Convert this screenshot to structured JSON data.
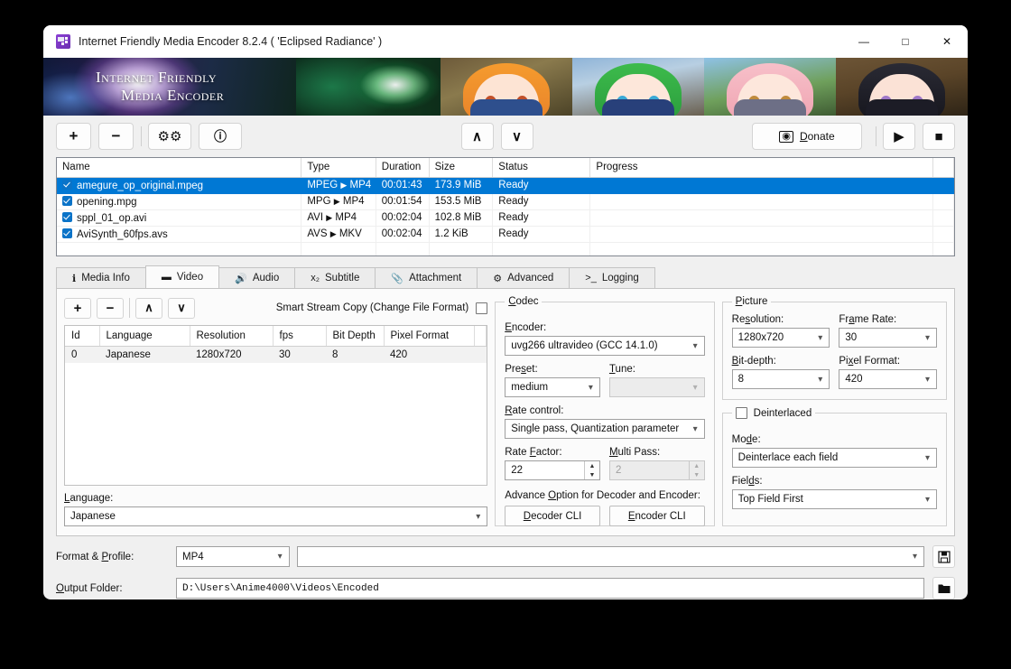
{
  "window": {
    "title": "Internet Friendly Media Encoder 8.2.4 ( 'Eclipsed Radiance' )",
    "minimize": "—",
    "maximize": "□",
    "close": "✕"
  },
  "banner": {
    "logo_line1": "Internet Friendly",
    "logo_line2": "Media Encoder"
  },
  "toolbar": {
    "add": "+",
    "remove": "−",
    "settings": "⚙",
    "info": "ℹ",
    "move_up": "∧",
    "move_down": "∨",
    "donate": "Donate",
    "donate_icon": "💵",
    "start": "▶",
    "stop": "■"
  },
  "filelist": {
    "columns": [
      "Name",
      "Type",
      "Duration",
      "Size",
      "Status",
      "Progress"
    ],
    "rows": [
      {
        "checked": true,
        "name": "amegure_op_original.mpeg",
        "type_from": "MPEG",
        "type_to": "MP4",
        "duration": "00:01:43",
        "size": "173.9 MiB",
        "status": "Ready",
        "progress": "",
        "selected": true
      },
      {
        "checked": true,
        "name": "opening.mpg",
        "type_from": "MPG",
        "type_to": "MP4",
        "duration": "00:01:54",
        "size": "153.5 MiB",
        "status": "Ready",
        "progress": "",
        "selected": false
      },
      {
        "checked": true,
        "name": "sppl_01_op.avi",
        "type_from": "AVI",
        "type_to": "MP4",
        "duration": "00:02:04",
        "size": "102.8 MiB",
        "status": "Ready",
        "progress": "",
        "selected": false
      },
      {
        "checked": true,
        "name": "AviSynth_60fps.avs",
        "type_from": "AVS",
        "type_to": "MKV",
        "duration": "00:02:04",
        "size": "1.2 KiB",
        "status": "Ready",
        "progress": "",
        "selected": false
      }
    ]
  },
  "tabs": [
    {
      "label": "Media Info",
      "icon": "info-icon",
      "glyph": "ℹ",
      "active": false
    },
    {
      "label": "Video",
      "icon": "video-camera-icon",
      "glyph": "▬",
      "active": true
    },
    {
      "label": "Audio",
      "icon": "speaker-icon",
      "glyph": "🔊",
      "active": false
    },
    {
      "label": "Subtitle",
      "icon": "subtitle-icon",
      "glyph": "x₂",
      "active": false
    },
    {
      "label": "Attachment",
      "icon": "paperclip-icon",
      "glyph": "📎",
      "active": false
    },
    {
      "label": "Advanced",
      "icon": "gear-icon",
      "glyph": "⚙",
      "active": false
    },
    {
      "label": "Logging",
      "icon": "console-icon",
      "glyph": ">_",
      "active": false
    }
  ],
  "video_tab": {
    "track_toolbar": {
      "add": "+",
      "remove": "−",
      "move_up": "∧",
      "move_down": "∨",
      "smart_stream_copy_label": "Smart Stream Copy (Change File Format)",
      "smart_stream_copy_checked": false
    },
    "track_table": {
      "columns": [
        "Id",
        "Language",
        "Resolution",
        "fps",
        "Bit Depth",
        "Pixel Format"
      ],
      "rows": [
        {
          "id": "0",
          "language": "Japanese",
          "resolution": "1280x720",
          "fps": "30",
          "bit_depth": "8",
          "pixel_format": "420"
        }
      ]
    },
    "language": {
      "label": "Language:",
      "value": "Japanese"
    },
    "codec": {
      "group_label": "Codec",
      "encoder_label": "Encoder:",
      "encoder_value": "uvg266 ultravideo (GCC 14.1.0)",
      "preset_label": "Preset:",
      "preset_value": "medium",
      "tune_label": "Tune:",
      "tune_value": "",
      "tune_disabled": true,
      "rate_control_label": "Rate control:",
      "rate_control_value": "Single pass, Quantization parameter",
      "rate_factor_label": "Rate Factor:",
      "rate_factor_value": "22",
      "multi_pass_label": "Multi Pass:",
      "multi_pass_value": "2",
      "multi_pass_disabled": true,
      "advance_label": "Advance Option for Decoder and Encoder:",
      "decoder_cli": "Decoder CLI",
      "encoder_cli": "Encoder CLI"
    },
    "picture": {
      "group_label": "Picture",
      "resolution_label": "Resolution:",
      "resolution_value": "1280x720",
      "frame_rate_label": "Frame Rate:",
      "frame_rate_value": "30",
      "bit_depth_label": "Bit-depth:",
      "bit_depth_value": "8",
      "pixel_format_label": "Pixel Format:",
      "pixel_format_value": "420"
    },
    "deinterlace": {
      "group_label": "Deinterlaced",
      "checked": false,
      "mode_label": "Mode:",
      "mode_value": "Deinterlace each field",
      "fields_label": "Fields:",
      "fields_value": "Top Field First"
    }
  },
  "bottom": {
    "format_profile_label": "Format & Profile:",
    "format_value": "MP4",
    "profile_value": "",
    "output_folder_label": "Output Folder:",
    "output_folder_value": "D:\\Users\\Anime4000\\Videos\\Encoded",
    "save_icon": "💾",
    "folder_icon": "📁"
  },
  "colors": {
    "accent": "#0078d4",
    "checkbox": "#0a73c8",
    "window_bg": "#f0f0f0",
    "panel_bg": "#fbfbfb"
  }
}
